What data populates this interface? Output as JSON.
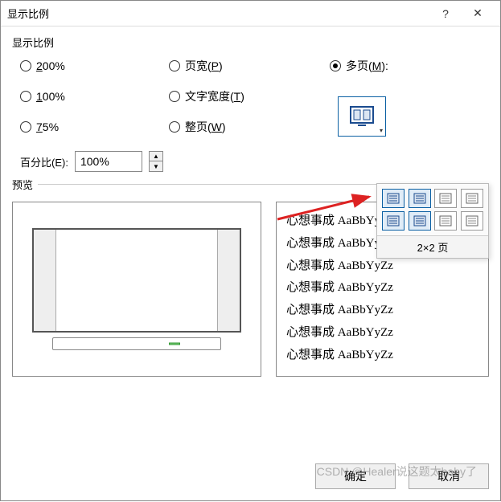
{
  "title": "显示比例",
  "group": {
    "zoom_label": "显示比例",
    "preview_label": "预览"
  },
  "radios": {
    "r200": "200%",
    "r100": "100%",
    "r75": "75%",
    "page_width": "页宽(P)",
    "text_width": "文字宽度(T)",
    "whole_page": "整页(W)",
    "many_pages": "多页(M):"
  },
  "percent": {
    "label": "百分比(E):",
    "value": "100%"
  },
  "popup": {
    "status": "2×2 页"
  },
  "sample": {
    "line": "心想事成 AaBbYyZz",
    "rows": 7
  },
  "buttons": {
    "ok": "确定",
    "cancel": "取消"
  },
  "watermark": "CSDN @Healer说这题太baby了"
}
